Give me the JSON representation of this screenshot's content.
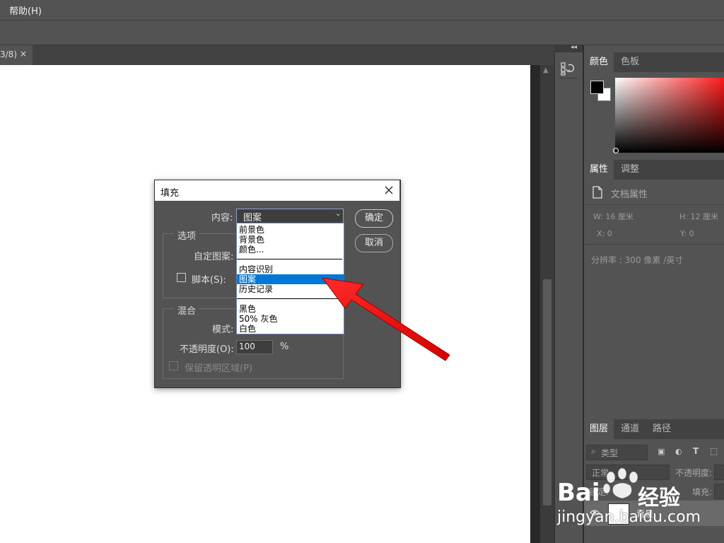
{
  "menubar": {
    "help_label": "帮助(H)"
  },
  "doc_tab": {
    "label": "3/8)",
    "close_glyph": "×"
  },
  "color_panel": {
    "tabs": [
      "颜色",
      "色板"
    ],
    "active_tab": 0,
    "accent": "#ff1a1a"
  },
  "properties_panel": {
    "tabs": [
      "属性",
      "调整"
    ],
    "active_tab": 0,
    "title": "文档属性",
    "width": "W:  16 厘米",
    "height": "H:  12 厘米",
    "x": "X:  0",
    "y": "Y:  0",
    "resolution": "分辨率 : 300 像素 /英寸"
  },
  "layers_panel": {
    "tabs": [
      "图层",
      "通道",
      "路径"
    ],
    "active_tab": 0,
    "filter_label": "类型",
    "blend_mode": "正常",
    "opacity_label": "不透明度:",
    "lock_label": "锁定:",
    "fill_label": "填充:",
    "layer_name": "背景"
  },
  "dialog": {
    "title": "填充",
    "content_label": "内容:",
    "content_value": "图案",
    "ok_label": "确定",
    "cancel_label": "取消",
    "options_legend": "选项",
    "custom_pattern_label": "自定图案:",
    "script_label": "脚本(S):",
    "blend_legend": "混合",
    "mode_label": "模式:",
    "opacity_label": "不透明度(O):",
    "opacity_value": "100",
    "percent": "%",
    "preserve_label": "保留透明区域(P)",
    "dropdown_items": [
      "前景色",
      "背景色",
      "颜色...",
      "内容识别",
      "图案",
      "历史记录",
      "黑色",
      "50% 灰色",
      "白色"
    ],
    "dropdown_selected": "图案"
  },
  "watermark": {
    "brand": "Bai",
    "brand2": "经验",
    "url": "jingyan.baidu.com"
  }
}
